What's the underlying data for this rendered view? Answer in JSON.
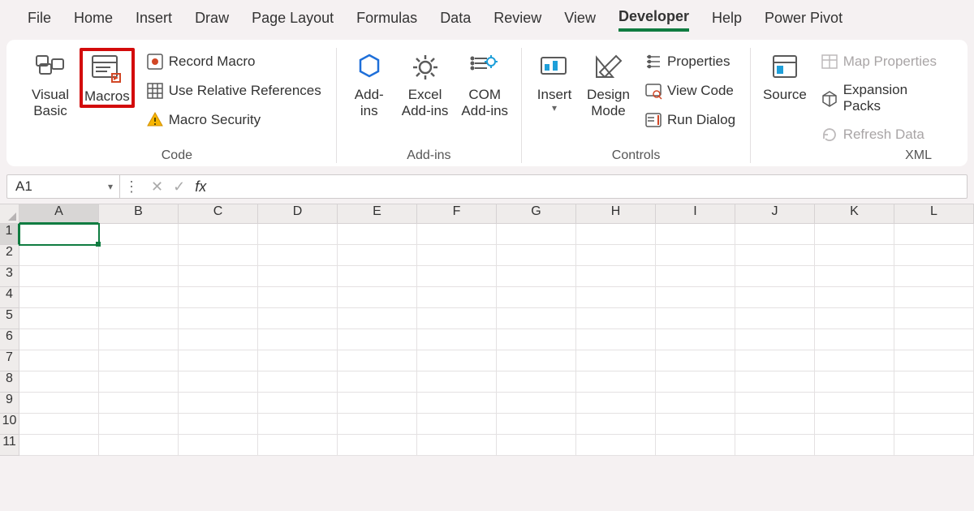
{
  "tabs": [
    "File",
    "Home",
    "Insert",
    "Draw",
    "Page Layout",
    "Formulas",
    "Data",
    "Review",
    "View",
    "Developer",
    "Help",
    "Power Pivot"
  ],
  "active_tab": "Developer",
  "ribbon": {
    "code": {
      "visual_basic": "Visual\nBasic",
      "macros": "Macros",
      "record_macro": "Record Macro",
      "use_relative": "Use Relative References",
      "macro_security": "Macro Security",
      "label": "Code"
    },
    "addins": {
      "addins": "Add-\nins",
      "excel_addins": "Excel\nAdd-ins",
      "com_addins": "COM\nAdd-ins",
      "label": "Add-ins"
    },
    "controls": {
      "insert": "Insert",
      "design_mode": "Design\nMode",
      "properties": "Properties",
      "view_code": "View Code",
      "run_dialog": "Run Dialog",
      "label": "Controls"
    },
    "xml": {
      "source": "Source",
      "map_properties": "Map Properties",
      "expansion_packs": "Expansion Packs",
      "refresh_data": "Refresh Data",
      "label": "XML"
    }
  },
  "name_box": "A1",
  "fx_label": "fx",
  "columns": [
    "A",
    "B",
    "C",
    "D",
    "E",
    "F",
    "G",
    "H",
    "I",
    "J",
    "K",
    "L"
  ],
  "rows": [
    "1",
    "2",
    "3",
    "4",
    "5",
    "6",
    "7",
    "8",
    "9",
    "10",
    "11"
  ],
  "selected_cell": {
    "col": "A",
    "row": "1"
  }
}
